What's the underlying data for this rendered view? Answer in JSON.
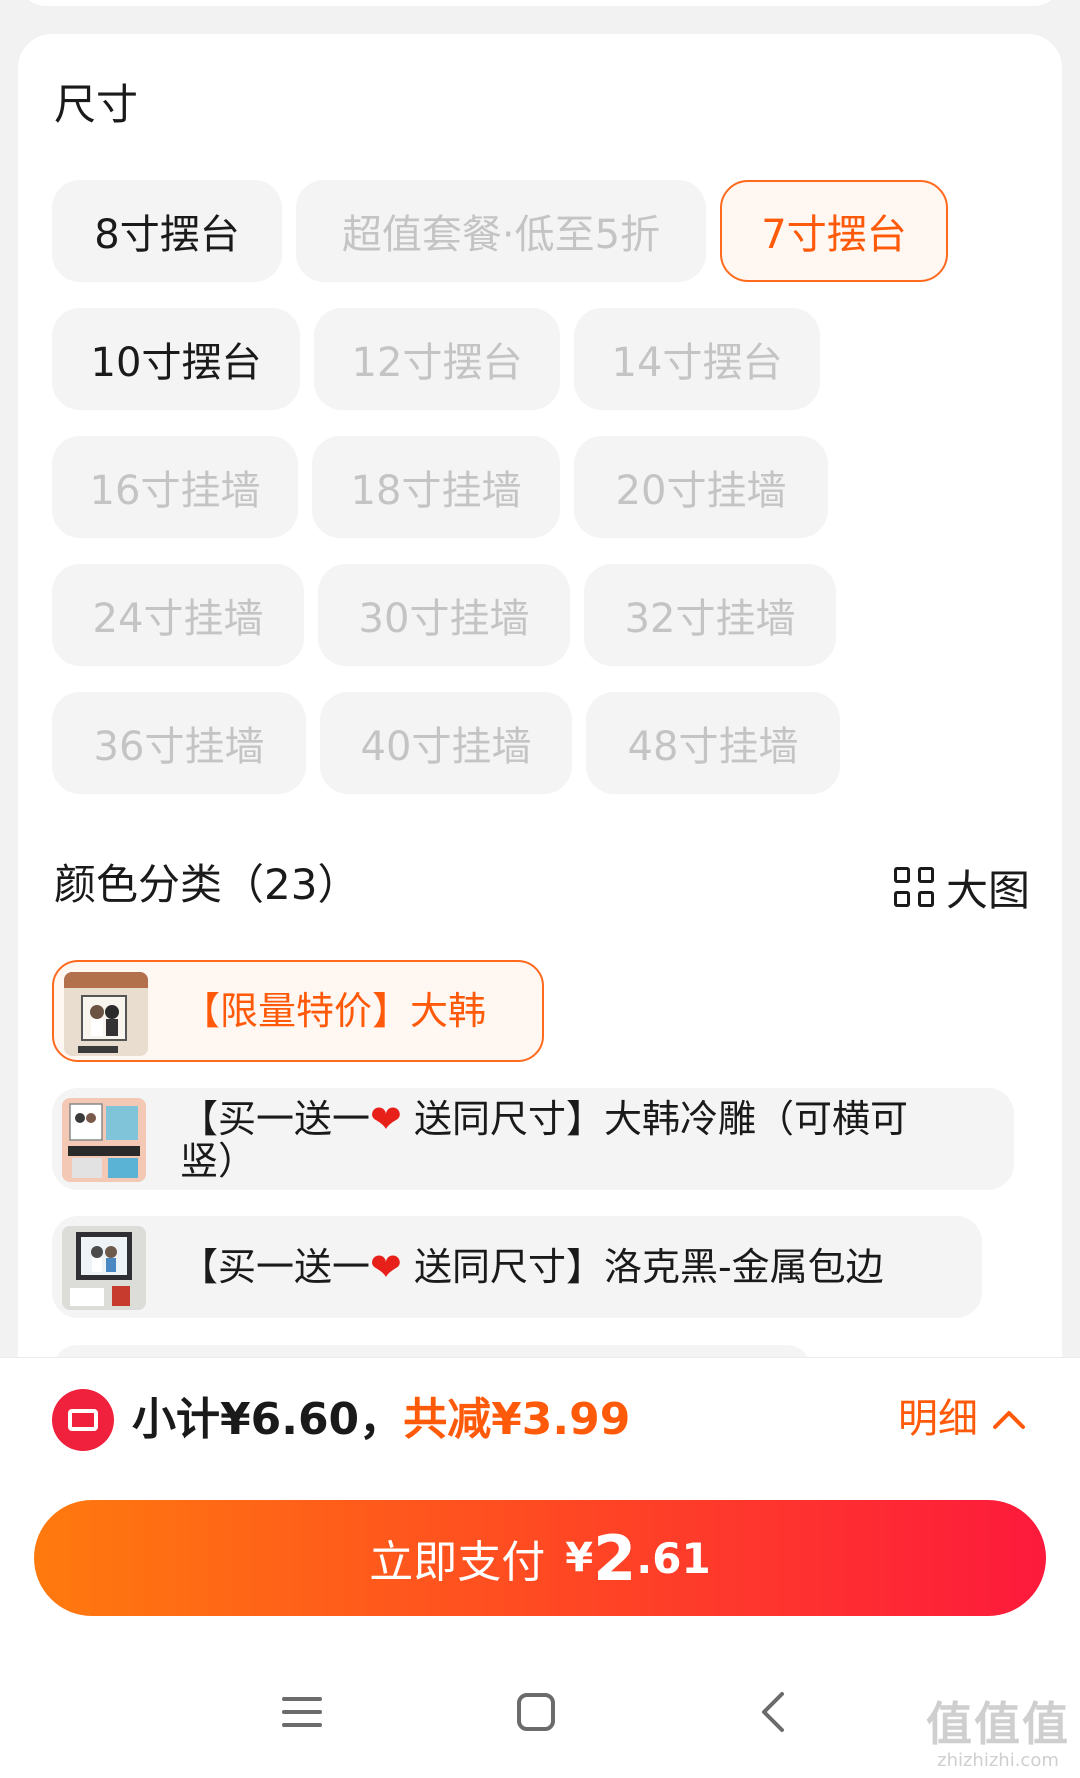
{
  "size_section": {
    "title": "尺寸",
    "options": [
      {
        "label": "8寸摆台",
        "state": "normal"
      },
      {
        "label": "超值套餐·低至5折",
        "state": "disabled"
      },
      {
        "label": "7寸摆台",
        "state": "selected"
      },
      {
        "label": "10寸摆台",
        "state": "normal"
      },
      {
        "label": "12寸摆台",
        "state": "disabled"
      },
      {
        "label": "14寸摆台",
        "state": "disabled"
      },
      {
        "label": "16寸挂墙",
        "state": "disabled"
      },
      {
        "label": "18寸挂墙",
        "state": "disabled"
      },
      {
        "label": "20寸挂墙",
        "state": "disabled"
      },
      {
        "label": "24寸挂墙",
        "state": "disabled"
      },
      {
        "label": "30寸挂墙",
        "state": "disabled"
      },
      {
        "label": "32寸挂墙",
        "state": "disabled"
      },
      {
        "label": "36寸挂墙",
        "state": "disabled"
      },
      {
        "label": "40寸挂墙",
        "state": "disabled"
      },
      {
        "label": "48寸挂墙",
        "state": "disabled"
      }
    ]
  },
  "color_section": {
    "title": "颜色分类（23）",
    "big_view_label": "大图",
    "items": [
      {
        "label": "【限量特价】大韩",
        "state": "selected"
      },
      {
        "label_line1_a": "【买一送一",
        "label_line1_b": " 送同尺寸】大韩冷雕（可横可",
        "label_line2": "竖）",
        "heart": "❤",
        "state": "normal"
      },
      {
        "label_a": "【买一送一",
        "label_b": " 送同尺寸】洛克黑-金属包边",
        "heart": "❤",
        "state": "normal"
      }
    ]
  },
  "summary": {
    "subtotal": "小计¥6.60，",
    "discount": "共减¥3.99",
    "detail_label": "明细"
  },
  "pay_button": {
    "label": "立即支付",
    "currency": "¥",
    "amount_int": "2",
    "amount_dec": ".61"
  },
  "watermark": {
    "big": "值值值",
    "small": "zhizhizhi.com"
  },
  "colors": {
    "accent": "#ff5a0a",
    "selected_bg": "#fff7f2",
    "pay_gradient_start": "#ff7a0e",
    "pay_gradient_end": "#fd1a3c",
    "coupon_red": "#f0213c",
    "disabled_text": "#c4c4c4"
  }
}
